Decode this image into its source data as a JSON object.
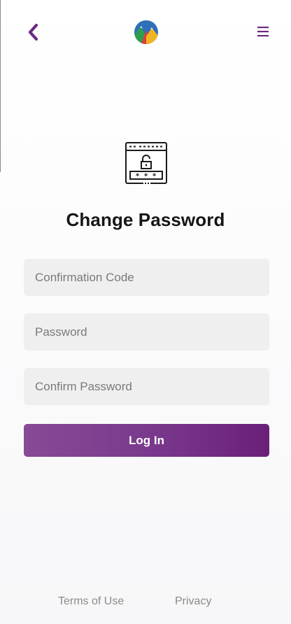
{
  "header": {
    "back_icon": "chevron-left-icon",
    "logo_icon": "mountains-logo-icon",
    "menu_icon": "hamburger-menu-icon",
    "accent_color": "#6b2a7f"
  },
  "main": {
    "hero_icon": "locked-password-window-icon",
    "title": "Change Password",
    "fields": {
      "confirmation_code": {
        "placeholder": "Confirmation Code",
        "value": ""
      },
      "password": {
        "placeholder": "Password",
        "value": ""
      },
      "confirm_password": {
        "placeholder": "Confirm Password",
        "value": ""
      }
    },
    "submit_label": "Log In"
  },
  "footer": {
    "terms_label": "Terms of Use",
    "privacy_label": "Privacy"
  }
}
